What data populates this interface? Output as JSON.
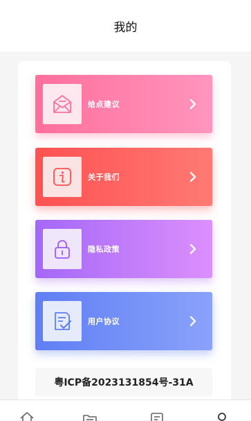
{
  "header": {
    "title": "我的"
  },
  "menu": [
    {
      "label": "给点建议",
      "icon": "mail-icon",
      "color": "#ff6f9c"
    },
    {
      "label": "关于我们",
      "icon": "info-icon",
      "color": "#ff5152"
    },
    {
      "label": "隐私政策",
      "icon": "lock-icon",
      "color": "#a368f7"
    },
    {
      "label": "用户协议",
      "icon": "document-check-icon",
      "color": "#5f7ff4"
    }
  ],
  "footer": {
    "icp": "粤ICP备2023131854号-31A"
  },
  "tabbar": {
    "items": [
      {
        "icon": "home-icon"
      },
      {
        "icon": "category-icon"
      },
      {
        "icon": "list-icon"
      },
      {
        "icon": "user-icon"
      }
    ]
  }
}
